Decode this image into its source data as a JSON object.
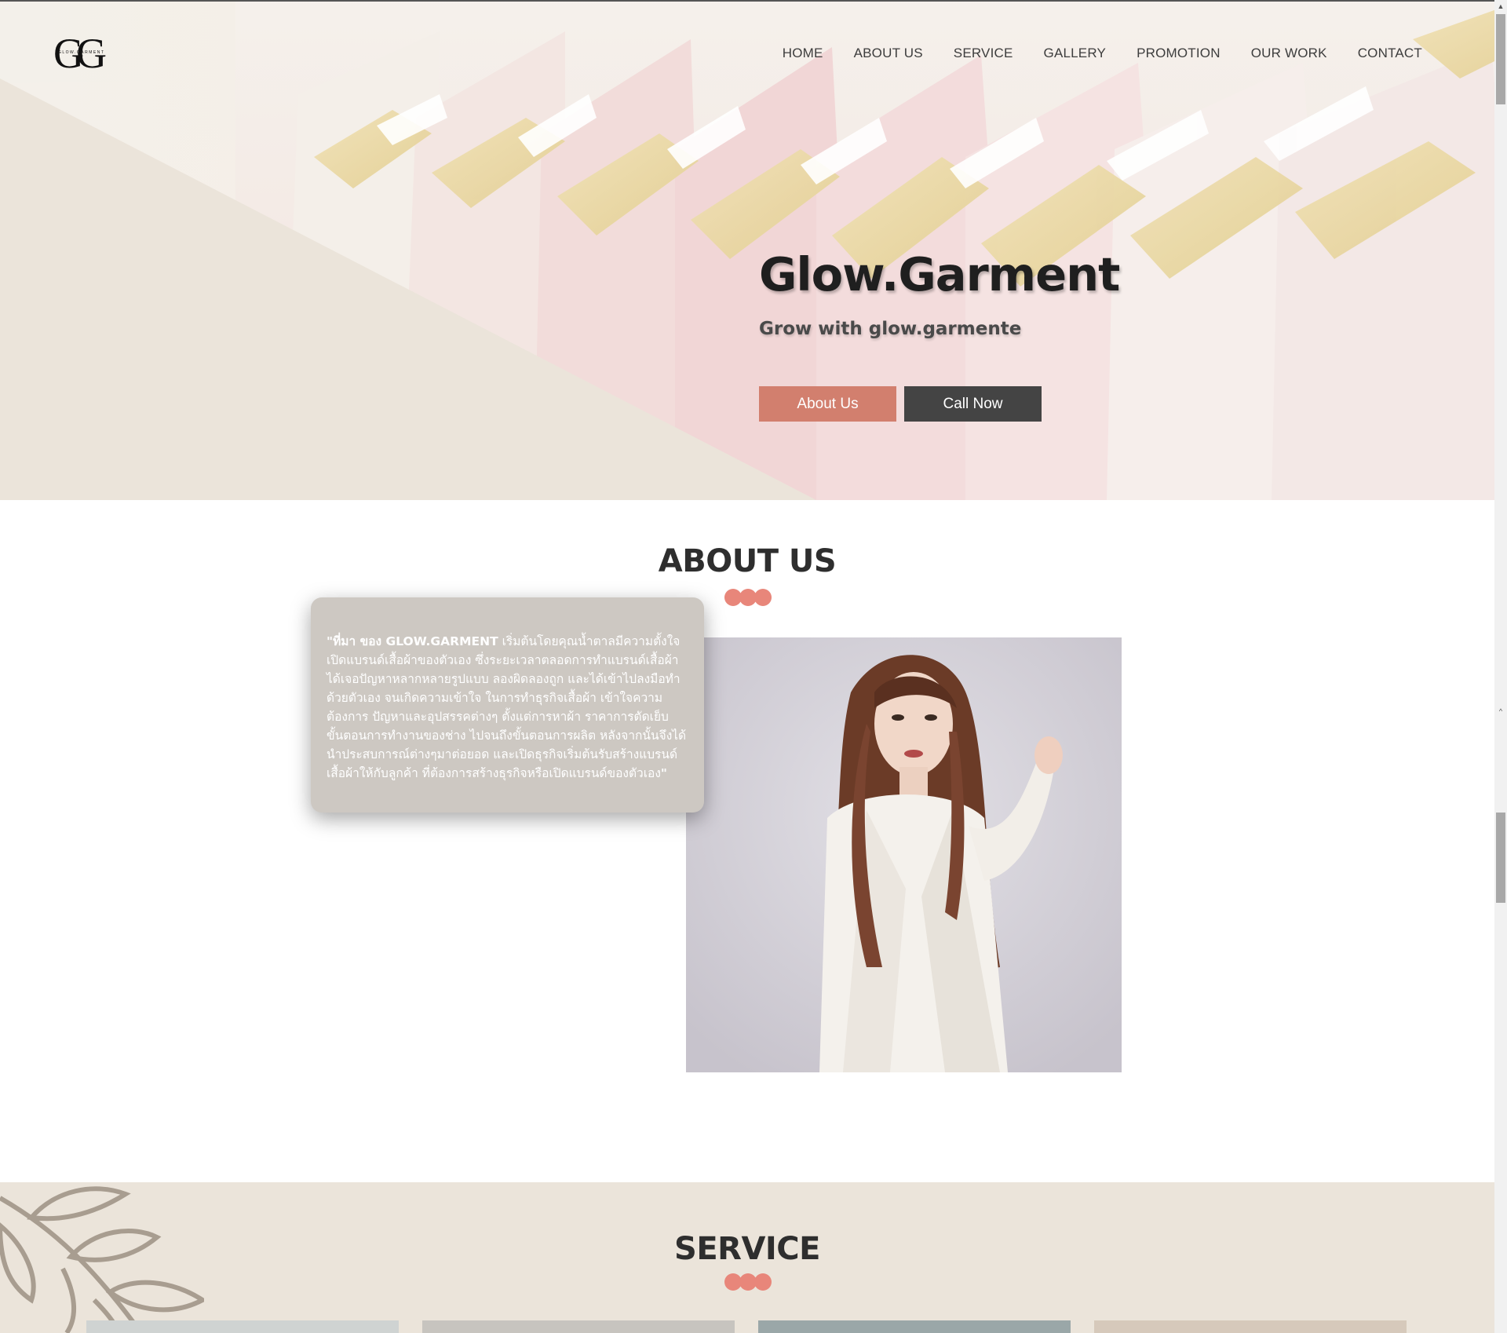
{
  "brand": {
    "logo_letters": "GG",
    "logo_sub": "GLOW.GARMENT"
  },
  "nav": {
    "items": [
      "HOME",
      "ABOUT US",
      "SERVICE",
      "GALLERY",
      "PROMOTION",
      "OUR WORK",
      "CONTACT"
    ]
  },
  "hero": {
    "title": "Glow.Garment",
    "subtitle": "Grow with glow.garmente",
    "about_button": "About Us",
    "call_button": "Call Now"
  },
  "about": {
    "title": "ABOUT US",
    "quote_open": "\"",
    "highlight": "ที่มา ของ GLOW.GARMENT",
    "body": " เริ่มต้นโดยคุณน้ำตาลมีความตั้งใจเปิดแบรนด์เสื้อผ้าของตัวเอง ซึ่งระยะเวลาตลอดการทำแบรนด์เสื้อผ้า ได้เจอปัญหาหลากหลายรูปแบบ ลองผิดลองถูก และได้เข้าไปลงมือทำด้วยตัวเอง จนเกิดความเข้าใจ ในการทำธุรกิจเสื้อผ้า เข้าใจความต้องการ ปัญหาและอุปสรรคต่างๆ ตั้งแต่การหาผ้า ราคาการตัดเย็บ ขั้นตอนการทำงานของช่าง ไปจนถึงขั้นตอนการผลิต หลังจากนั้นจึงได้นำประสบการณ์ต่างๆมาต่อยอด และเปิดธุรกิจเริ่มต้นรับสร้างแบรนด์เสื้อผ้าให้กับลูกค้า ที่ต้องการสร้างธุรกิจหรือเปิดแบรนด์ของตัวเอง",
    "quote_close": "\""
  },
  "service": {
    "title": "SERVICE"
  },
  "colors": {
    "accent": "#d27f6e",
    "dots": "#e8867a",
    "dark_button": "#444444",
    "beige": "#ebe4da"
  },
  "icons": {
    "scroll_up": "chevron-up-icon"
  }
}
